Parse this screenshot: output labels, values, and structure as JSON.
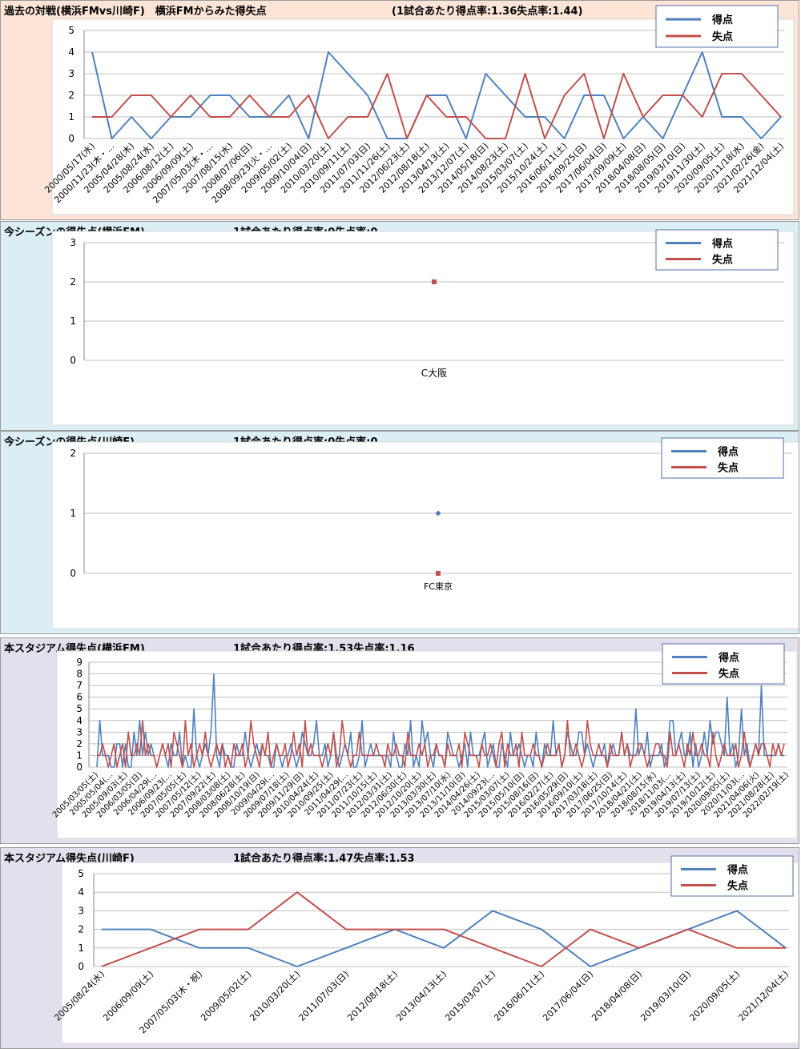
{
  "colors": {
    "goal": "#4f81bd",
    "loss": "#c0504d"
  },
  "panels": [
    {
      "title": "過去の対戦(横浜FMvs川崎F)　横浜FMからみた得失点",
      "rate": "(1試合あたり得点率:1.36失点率:1.44)",
      "bg": "#fce4d6",
      "legend": {
        "goal": "得点",
        "loss": "失点"
      }
    },
    {
      "title": "今シーズンの得失点(横浜FM)",
      "rate": "1試合あたり得点率:0失点率:0",
      "bg": "#daeef3",
      "legend": {
        "goal": "得点",
        "loss": "失点"
      }
    },
    {
      "title": "今シーズンの得失点(川崎F)",
      "rate": "1試合あたり得点率:0失点率:0",
      "bg": "#daeef3",
      "legend": {
        "goal": "得点",
        "loss": "失点"
      }
    },
    {
      "title": "本スタジアム得失点(横浜FM)",
      "rate": "1試合あたり得点率:1.53失点率:1.16",
      "bg": "#e4dfec",
      "legend": {
        "goal": "得点",
        "loss": "失点"
      }
    },
    {
      "title": "本スタジアム得失点(川崎F)",
      "rate": "1試合あたり得点率:1.47失点率:1.53",
      "bg": "#e4dfec",
      "legend": {
        "goal": "得点",
        "loss": "失点"
      }
    }
  ],
  "chart_data": [
    {
      "type": "line",
      "ylim": [
        0,
        5
      ],
      "yticks": [
        0,
        1,
        2,
        3,
        4,
        5
      ],
      "x": [
        "2000/05/17(水)",
        "2000/11/23(木・…",
        "2005/04/28(木)",
        "2005/08/24(水)",
        "2006/08/12(土)",
        "2006/09/09(土)",
        "2007/05/03(木・…",
        "2007/08/15(水)",
        "2008/07/06(日)",
        "2008/09/23(火・…",
        "2009/05/02(土)",
        "2009/10/04(日)",
        "2010/03/20(土)",
        "2010/09/11(土)",
        "2011/07/03(日)",
        "2011/11/26(土)",
        "2012/06/23(土)",
        "2012/08/18(土)",
        "2013/04/13(土)",
        "2013/12/07(土)",
        "2014/05/18(日)",
        "2014/08/23(土)",
        "2015/03/07(土)",
        "2015/10/24(土)",
        "2016/06/11(土)",
        "2016/09/25(日)",
        "2017/06/04(日)",
        "2017/09/09(土)",
        "2018/04/08(日)",
        "2018/08/05(日)",
        "2019/03/10(日)",
        "2019/11/30(土)",
        "2020/09/05(土)",
        "2020/11/18(水)",
        "2021/02/26(金)",
        "2021/12/04(土)"
      ],
      "xlabels_shown": [
        "2000/05/17(水)",
        "2000/11/23(木・…",
        "2005/04/28(木)",
        "2005/08/24(水)",
        "2006/08/12(土)",
        "2006/09/09(土)",
        "2007/05/03(木・…",
        "2007/08/15(水)",
        "2008/07/06(日)",
        "2008/09/23(火・…",
        "2009/05/02(土)",
        "2009/10/04(日)",
        "2010/03/20(土)",
        "2010/09/11(土)",
        "2011/07/03(日)",
        "2011/11/26(土)",
        "2012/06/23(土)",
        "2012/08/18(土)",
        "2013/04/13(土)",
        "2013/12/07(土)",
        "2014/05/18(日)",
        "2014/08/23(土)",
        "2015/03/07(土)",
        "2015/10/24(土)",
        "2016/06/11(土)",
        "2016/09/25(日)",
        "2017/06/04(日)",
        "2017/09/09(土)",
        "2018/04/08(日)",
        "2018/08/05(日)",
        "2019/03/10(日)",
        "2019/11/30(土)",
        "2020/09/05(土)",
        "2020/11/18(水)",
        "2021/02/26(金)",
        "2021/12/04(土)"
      ],
      "series": [
        {
          "name": "得点",
          "values": [
            4,
            0,
            1,
            0,
            1,
            1,
            2,
            2,
            1,
            1,
            2,
            0,
            4,
            3,
            2,
            0,
            0,
            2,
            2,
            0,
            3,
            2,
            1,
            1,
            0,
            2,
            2,
            0,
            1,
            0,
            2,
            4,
            1,
            1,
            0,
            1
          ]
        },
        {
          "name": "失点",
          "values": [
            1,
            1,
            2,
            2,
            1,
            2,
            1,
            1,
            2,
            1,
            1,
            2,
            0,
            1,
            1,
            3,
            0,
            2,
            1,
            1,
            0,
            0,
            3,
            0,
            2,
            3,
            0,
            3,
            1,
            2,
            2,
            1,
            3,
            3,
            2,
            1
          ]
        }
      ]
    },
    {
      "type": "line",
      "ylim": [
        0,
        3
      ],
      "yticks": [
        0,
        1,
        2,
        3
      ],
      "x": [
        "C大阪"
      ],
      "xlabels_shown": [
        "C大阪"
      ],
      "series": [
        {
          "name": "得点",
          "values": [
            2
          ]
        },
        {
          "name": "失点",
          "values": [
            2
          ]
        }
      ]
    },
    {
      "type": "line",
      "ylim": [
        0,
        2
      ],
      "yticks": [
        0,
        1,
        2
      ],
      "x": [
        "FC東京"
      ],
      "xlabels_shown": [
        "FC東京"
      ],
      "series": [
        {
          "name": "得点",
          "values": [
            1
          ]
        },
        {
          "name": "失点",
          "values": [
            0
          ]
        }
      ]
    },
    {
      "type": "line",
      "ylim": [
        0,
        9
      ],
      "yticks": [
        0,
        1,
        2,
        3,
        4,
        5,
        6,
        7,
        8,
        9
      ],
      "point_count": 242,
      "xlabels_shown": [
        "2005/03/05(土)",
        "2005/05/04(…",
        "2005/09/03(土)",
        "2006/03/05(日)",
        "2006/04/29(…",
        "2006/09/23(…",
        "2007/05/05(土)",
        "2007/05/12(土)",
        "2007/09/22(土)",
        "2008/03/08(土)",
        "2008/06/28(土)",
        "2008/10/19(日)",
        "2009/04/29(…",
        "2009/07/18(土)",
        "2009/11/29(日)",
        "2010/04/24(土)",
        "2010/09/25(土)",
        "2011/04/29(…",
        "2011/07/23(土)",
        "2011/10/15(土)",
        "2012/03/31(土)",
        "2012/06/30(土)",
        "2012/10/20(土)",
        "2013/03/30(土)",
        "2013/07/10(水)",
        "2013/11/10(日)",
        "2014/04/26(土)",
        "2014/09/23(…",
        "2015/03/07(土)",
        "2015/05/10(日)",
        "2015/08/16(日)",
        "2016/02/27(土)",
        "2016/05/29(日)",
        "2016/09/10(土)",
        "2017/03/18(土)",
        "2017/06/25(日)",
        "2017/10/14(土)",
        "2018/04/21(土)",
        "2018/08/15(水)",
        "2018/11/03(…",
        "2019/04/13(土)",
        "2019/07/13(土)",
        "2019/10/12(土)",
        "2020/09/05(土)",
        "2020/11/03(…",
        "2021/04/06(火)",
        "2021/08/28(土)",
        "2022/02/19(土)"
      ],
      "series": [
        {
          "name": "得点",
          "values": [
            0,
            4,
            1,
            1,
            1,
            0,
            0,
            2,
            2,
            0,
            2,
            0,
            0,
            3,
            1,
            4,
            1,
            3,
            1,
            2,
            1,
            0,
            1,
            2,
            1,
            0,
            2,
            1,
            1,
            3,
            0,
            1,
            0,
            0,
            5,
            1,
            0,
            1,
            2,
            1,
            3,
            8,
            1,
            0,
            2,
            1,
            1,
            0,
            0,
            2,
            1,
            1,
            3,
            1,
            0,
            1,
            2,
            1,
            2,
            1,
            1,
            0,
            0,
            2,
            1,
            0,
            1,
            1,
            2,
            1,
            0,
            1,
            3,
            2,
            1,
            1,
            2,
            4,
            1,
            1,
            2,
            0,
            1,
            3,
            1,
            0,
            1,
            2,
            1,
            3,
            0,
            0,
            1,
            4,
            0,
            1,
            2,
            1,
            1,
            1,
            1,
            1,
            1,
            0,
            3,
            1,
            0,
            0,
            2,
            1,
            4,
            0,
            1,
            0,
            4,
            2,
            3,
            1,
            0,
            2,
            1,
            1,
            0,
            3,
            2,
            1,
            1,
            0,
            1,
            2,
            0,
            3,
            1,
            1,
            1,
            2,
            3,
            0,
            1,
            2,
            0,
            0,
            2,
            1,
            0,
            3,
            1,
            1,
            2,
            1,
            0,
            1,
            1,
            0,
            3,
            1,
            0,
            2,
            1,
            1,
            4,
            1,
            2,
            0,
            1,
            3,
            2,
            1,
            1,
            3,
            3,
            1,
            2,
            1,
            0,
            1,
            1,
            1,
            2,
            0,
            1,
            2,
            1,
            1,
            3,
            1,
            2,
            1,
            1,
            5,
            1,
            2,
            1,
            3,
            0,
            1,
            1,
            1,
            2,
            0,
            1,
            4,
            4,
            1,
            2,
            3,
            1,
            1,
            3,
            0,
            2,
            0,
            1,
            3,
            1,
            4,
            2,
            3,
            3,
            2,
            1,
            6,
            1,
            2,
            0,
            1,
            5,
            1,
            2,
            0,
            1,
            2,
            1,
            7,
            1,
            1,
            1,
            1,
            1,
            2,
            1,
            1
          ]
        },
        {
          "name": "失点",
          "values": [
            1,
            1,
            2,
            1,
            0,
            1,
            2,
            0,
            1,
            2,
            0,
            3,
            1,
            1,
            2,
            1,
            4,
            1,
            2,
            1,
            1,
            0,
            1,
            2,
            1,
            2,
            0,
            3,
            2,
            1,
            0,
            4,
            1,
            2,
            0,
            1,
            2,
            1,
            3,
            1,
            0,
            1,
            2,
            1,
            2,
            0,
            1,
            0,
            2,
            1,
            1,
            2,
            0,
            1,
            4,
            2,
            1,
            0,
            2,
            1,
            3,
            0,
            1,
            2,
            1,
            1,
            2,
            0,
            1,
            3,
            1,
            2,
            0,
            4,
            1,
            2,
            1,
            1,
            1,
            0,
            1,
            2,
            1,
            3,
            0,
            1,
            4,
            2,
            1,
            0,
            1,
            1,
            3,
            1,
            1,
            1,
            1,
            1,
            2,
            1,
            1,
            0,
            2,
            1,
            1,
            2,
            1,
            1,
            0,
            3,
            1,
            1,
            1,
            2,
            1,
            2,
            0,
            1,
            1,
            2,
            1,
            1,
            0,
            2,
            1,
            1,
            1,
            2,
            0,
            3,
            2,
            1,
            1,
            1,
            0,
            2,
            1,
            1,
            2,
            1,
            0,
            2,
            3,
            0,
            2,
            1,
            1,
            2,
            0,
            3,
            1,
            1,
            1,
            2,
            1,
            1,
            0,
            1,
            2,
            1,
            1,
            1,
            2,
            0,
            1,
            4,
            1,
            1,
            2,
            1,
            0,
            1,
            4,
            2,
            1,
            1,
            2,
            1,
            1,
            0,
            2,
            1,
            1,
            1,
            3,
            1,
            2,
            0,
            1,
            1,
            2,
            2,
            1,
            0,
            1,
            1,
            2,
            2,
            1,
            1,
            0,
            3,
            1,
            1,
            2,
            1,
            0,
            2,
            1,
            3,
            1,
            1,
            2,
            1,
            1,
            0,
            3,
            1,
            0,
            1,
            2,
            1,
            1,
            1,
            2,
            0,
            1,
            3,
            1,
            0,
            1,
            2,
            1,
            2,
            2,
            1,
            0,
            2,
            1,
            2,
            1,
            2
          ]
        }
      ]
    },
    {
      "type": "line",
      "ylim": [
        0,
        5
      ],
      "yticks": [
        0,
        1,
        2,
        3,
        4,
        5
      ],
      "x": [
        "2005/08/24(水)",
        "2006/09/09(土)",
        "2007/05/03(木・祝)",
        "2009/05/02(土)",
        "2010/03/20(土)",
        "2011/07/03(日)",
        "2012/08/18(土)",
        "2013/04/13(土)",
        "2015/03/07(土)",
        "2016/06/11(土)",
        "2017/06/04(日)",
        "2018/04/08(日)",
        "2019/03/10(日)",
        "2020/09/05(土)",
        "2021/12/04(土)"
      ],
      "xlabels_shown": [
        "2005/08/24(水)",
        "2006/09/09(土)",
        "2007/05/03(木・祝)",
        "2009/05/02(土)",
        "2010/03/20(土)",
        "2011/07/03(日)",
        "2012/08/18(土)",
        "2013/04/13(土)",
        "2015/03/07(土)",
        "2016/06/11(土)",
        "2017/06/04(日)",
        "2018/04/08(日)",
        "2019/03/10(日)",
        "2020/09/05(土)",
        "2021/12/04(土)"
      ],
      "series": [
        {
          "name": "得点",
          "values": [
            2,
            2,
            1,
            1,
            0,
            1,
            2,
            1,
            3,
            2,
            0,
            1,
            2,
            3,
            1
          ]
        },
        {
          "name": "失点",
          "values": [
            0,
            1,
            2,
            2,
            4,
            2,
            2,
            2,
            1,
            0,
            2,
            1,
            2,
            1,
            1
          ]
        }
      ]
    }
  ]
}
